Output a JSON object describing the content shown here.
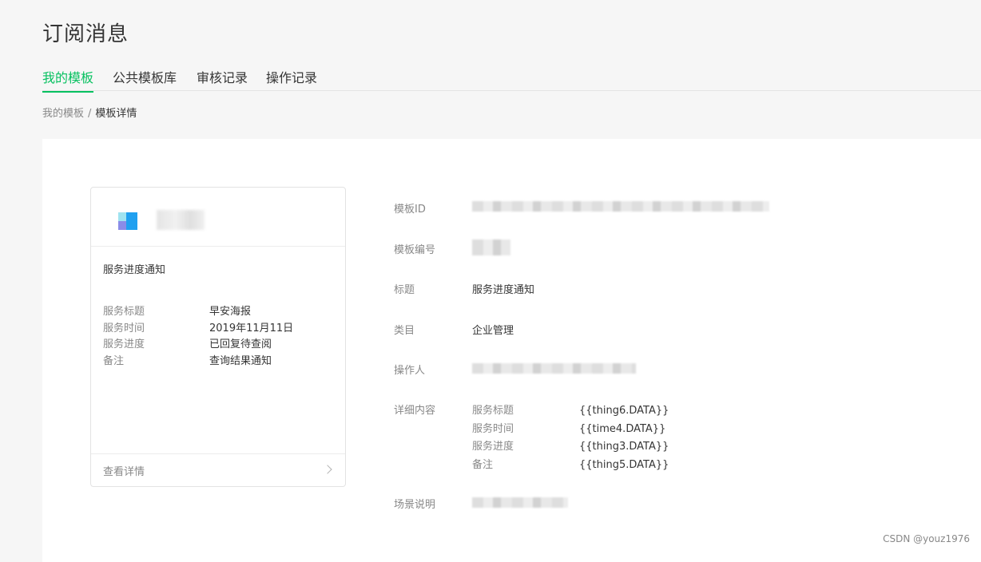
{
  "page": {
    "title": "订阅消息"
  },
  "tabs": [
    {
      "label": "我的模板",
      "active": true
    },
    {
      "label": "公共模板库",
      "active": false
    },
    {
      "label": "审核记录",
      "active": false
    },
    {
      "label": "操作记录",
      "active": false
    }
  ],
  "breadcrumb": {
    "parent": "我的模板",
    "separator": "/",
    "current": "模板详情"
  },
  "preview_card": {
    "title": "服务进度通知",
    "fields": [
      {
        "key": "服务标题",
        "value": "早安海报"
      },
      {
        "key": "服务时间",
        "value": "2019年11月11日"
      },
      {
        "key": "服务进度",
        "value": "已回复待查阅"
      },
      {
        "key": "备注",
        "value": "查询结果通知"
      }
    ],
    "footer_link": "查看详情",
    "chevron_icon": "chevron-right-icon"
  },
  "detail": {
    "template_id_label": "模板ID",
    "template_no_label": "模板编号",
    "title_label": "标题",
    "title_value": "服务进度通知",
    "category_label": "类目",
    "category_value": "企业管理",
    "operator_label": "操作人",
    "content_label": "详细内容",
    "content_rows": [
      {
        "key": "服务标题",
        "value": "{{thing6.DATA}}"
      },
      {
        "key": "服务时间",
        "value": "{{time4.DATA}}"
      },
      {
        "key": "服务进度",
        "value": "{{thing3.DATA}}"
      },
      {
        "key": "备注",
        "value": "{{thing5.DATA}}"
      }
    ],
    "scene_label": "场景说明"
  },
  "colors": {
    "accent": "#07c160",
    "text": "#353535",
    "muted": "#888888",
    "background": "#f6f6f6"
  },
  "watermark": "CSDN @youz1976"
}
